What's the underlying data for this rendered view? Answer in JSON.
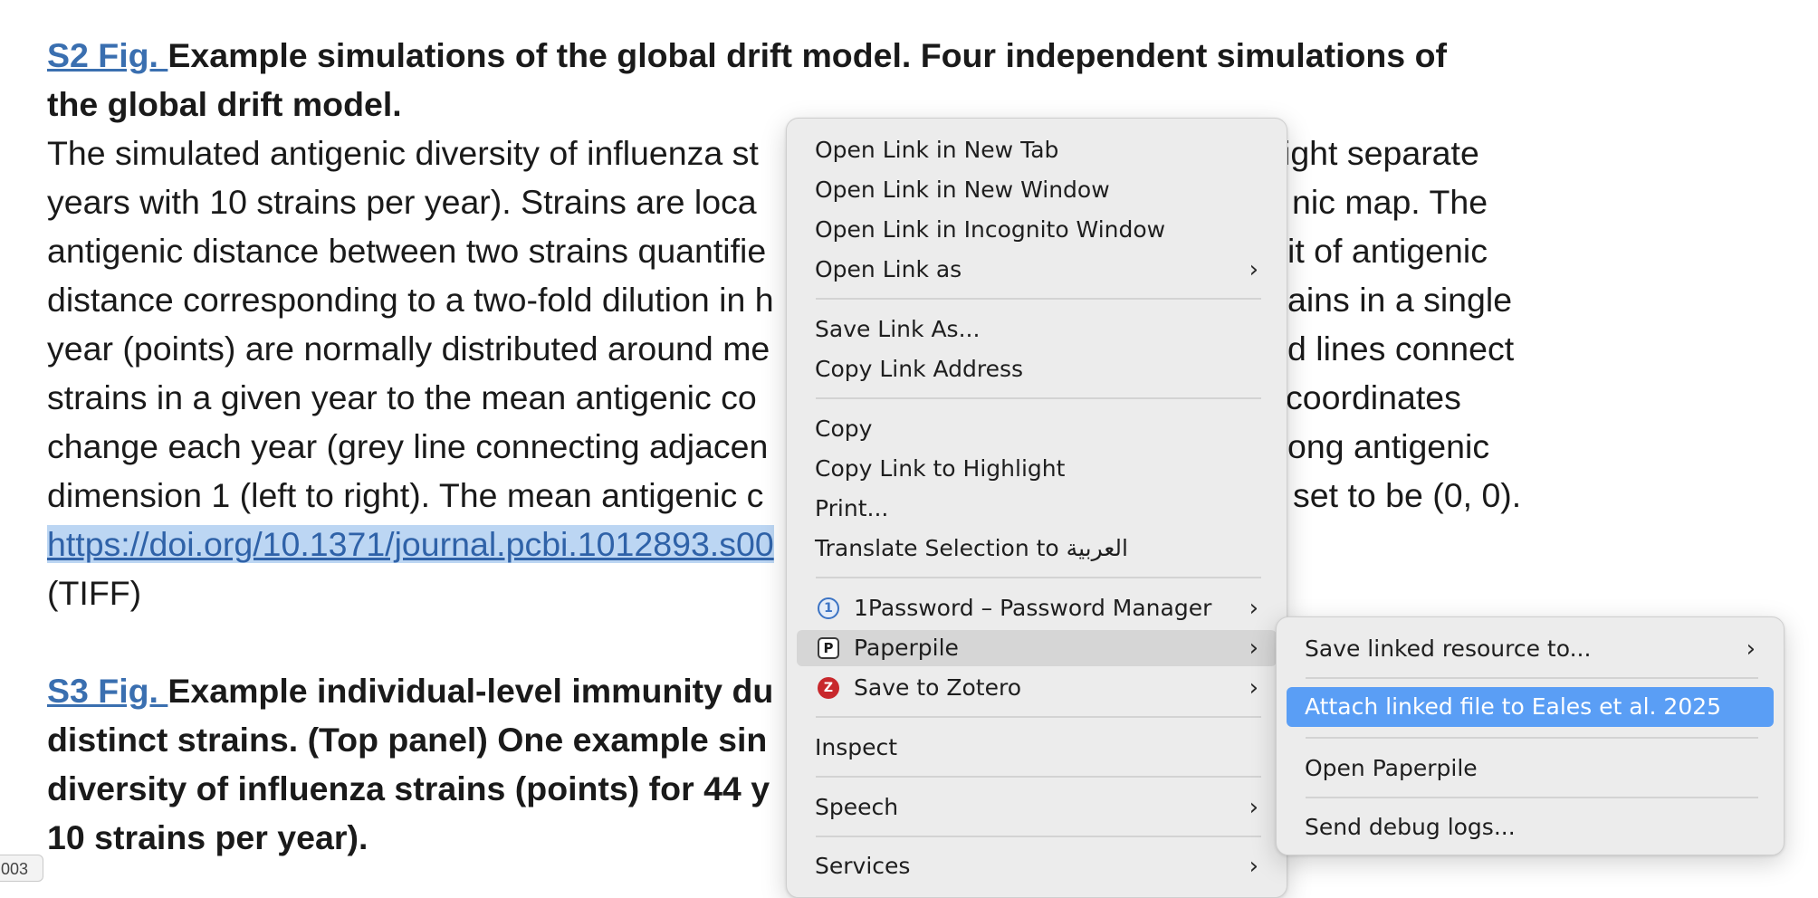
{
  "article": {
    "s2": {
      "link": "S2 Fig. ",
      "title_line1": "Example simulations of the global drift model. Four independent simulations of",
      "title_line2": "the global drift model."
    },
    "body_lines": [
      "The simulated antigenic diversity of influenza st",
      "years with 10 strains per year). Strains are loca",
      "antigenic distance between two strains quantifie",
      "distance corresponding to a two-fold dilution in h",
      "year (points) are normally distributed around me",
      "strains in a given year to the mean antigenic co",
      "change each year (grey line connecting adjacen",
      "dimension 1 (left to right). The mean antigenic c"
    ],
    "body_right": [
      "ight separate",
      "nic map. The",
      "it of antigenic",
      "ains in a single",
      "d lines connect",
      "coordinates",
      "ong antigenic",
      "set to be (0, 0)."
    ],
    "doi_link": "https://doi.org/10.1371/journal.pcbi.1012893.s00",
    "format_label": "(TIFF)",
    "s3": {
      "link": "S3 Fig. ",
      "lines": [
        "Example individual-level immunity du",
        "distinct strains. (Top panel) One example sin",
        "diversity of influenza strains (points) for 44 y",
        "10 strains per year)."
      ]
    },
    "status_chip": "003"
  },
  "context_menu": {
    "items": [
      {
        "label": "Open Link in New Tab"
      },
      {
        "label": "Open Link in New Window"
      },
      {
        "label": "Open Link in Incognito Window"
      },
      {
        "label": "Open Link as",
        "submenu": true
      },
      {
        "label": "Save Link As..."
      },
      {
        "label": "Copy Link Address"
      },
      {
        "label": "Copy"
      },
      {
        "label": "Copy Link to Highlight"
      },
      {
        "label": "Print..."
      },
      {
        "label": "Translate Selection to العربية"
      },
      {
        "label": "1Password – Password Manager",
        "icon": "1password-icon",
        "submenu": true
      },
      {
        "label": "Paperpile",
        "icon": "paperpile-icon",
        "submenu": true
      },
      {
        "label": "Save to Zotero",
        "icon": "zotero-icon",
        "submenu": true
      },
      {
        "label": "Inspect"
      },
      {
        "label": "Speech",
        "submenu": true
      },
      {
        "label": "Services",
        "submenu": true
      }
    ],
    "submenu_arrow": "›"
  },
  "paperpile_submenu": {
    "items": [
      {
        "label": "Save linked resource to...",
        "submenu": true
      },
      {
        "label": "Attach linked file to Eales et al. 2025",
        "highlighted": true
      },
      {
        "label": "Open Paperpile"
      },
      {
        "label": "Send debug logs..."
      }
    ]
  },
  "icons": {
    "onepassword_glyph": "1",
    "paperpile_glyph": "P",
    "zotero_glyph": "Z"
  },
  "colors": {
    "link": "#3a6fb0",
    "selection": "#bcd6f3",
    "menu_highlight": "#5a9ef5",
    "zotero": "#c8282c",
    "onepassword": "#3b73c4"
  }
}
